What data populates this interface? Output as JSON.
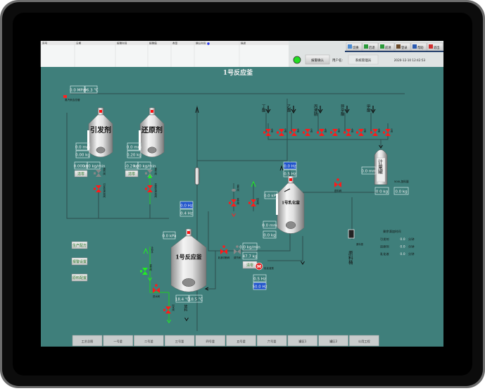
{
  "alarm_table": {
    "columns": [
      "序号",
      "日期",
      "报警时间",
      "报警值",
      "类型",
      "确认时间",
      "描述"
    ]
  },
  "toolbar": {
    "buttons": [
      {
        "label": "切换",
        "icon": "switch-icon"
      },
      {
        "label": "后退",
        "icon": "back-icon"
      },
      {
        "label": "前进",
        "icon": "forward-icon"
      },
      {
        "label": "登录",
        "icon": "user-icon"
      },
      {
        "label": "帮助",
        "icon": "help-icon"
      },
      {
        "label": "退出",
        "icon": "exit-icon"
      }
    ],
    "alarm_confirm": "报警确认",
    "user_label": "用户名:",
    "user_name": "系统管理员",
    "datetime": "2020-12-10 12:42:53",
    "status_color": "#22dd22"
  },
  "title": "1号反应釜",
  "steam": {
    "pressure": "0.0 MPa",
    "temp": "96.3 ℃",
    "label": "蒸汽来自总管"
  },
  "initiator": {
    "name": "引发剂",
    "level": "0.0 mm",
    "weight": "0.00 kg",
    "dose": "0.00 kg",
    "rate": "0.00 kg/min",
    "reset": "清零",
    "valve1": "调节阀",
    "valve2": "引发剂滴加阀"
  },
  "reducer": {
    "name": "还原剂",
    "level": "0.0 mm",
    "weight": "0.20 kg",
    "dose": "-0.2 kg",
    "rate": "0.00 kg/min",
    "reset": "清零",
    "valve1": "调节阀",
    "valve2": "还原剂滴加阀"
  },
  "monomers": [
    {
      "name": "丁酯"
    },
    {
      "name": "乙酯"
    },
    {
      "name": "丙烯腈"
    },
    {
      "name": "异辛酯"
    },
    {
      "name": "甲酯"
    }
  ],
  "monomer_valve_labels": [
    "大阀",
    "小阀"
  ],
  "metering_tank": {
    "name": "计量罐",
    "level": "0.0 mm",
    "weight": "0.0 kg",
    "dose_label": "500L加料量",
    "dose": "0.0 kg"
  },
  "emulsion_tank": {
    "name": "1号乳化釜",
    "freq_set": "0.0 Hz",
    "freq": "0.5 Hz",
    "pressure": "0.0 kPa",
    "level": "0.0 mm",
    "weight": "0.0 kg",
    "feed_valve": "进料阀"
  },
  "reactor": {
    "name": "1号反应釜",
    "freq_set": "0.0 Hz",
    "freq": "0.4 Hz",
    "pressure": "0.0 kPa",
    "temp1": "18.4 ℃",
    "temp2": "18.5 ℃",
    "discharge": "放料",
    "vent_valve": "放空阀",
    "water_valve": "回水阀",
    "cool_in": "冷却水",
    "reg_valve": "调节阀",
    "return_valve": "回水阀",
    "inlet_valve": "进水阀"
  },
  "pump": {
    "flow": "0.0 kg/min",
    "weight": "47.7 kg",
    "reset": "清零",
    "freq": "0.5 Hz",
    "freq_set": "50.0 Hz",
    "label": "乳化液泵",
    "valve1": "乳液切断阀",
    "valve2": "调节阀"
  },
  "left_buttons": [
    "生产配方",
    "报警设置",
    "原料配置"
  ],
  "raw_material": {
    "pump": "原料泵",
    "barrel": "原料桶"
  },
  "remaining": {
    "title": "剩余滴加时间",
    "rows": [
      {
        "name": "引发剂",
        "value": "0.0",
        "unit": "分钟"
      },
      {
        "name": "还原剂",
        "value": "0.0",
        "unit": "分钟"
      },
      {
        "name": "乳化液",
        "value": "0.0",
        "unit": "分钟"
      }
    ]
  },
  "nav_tabs": [
    "工艺总图",
    "一号釜",
    "二号釜",
    "三号釜",
    "四号釜",
    "五号釜",
    "六号釜",
    "罐区1",
    "罐区2",
    "公用工程"
  ],
  "colors": {
    "background": "#3f7f7b",
    "valve_closed": "#ff1a1a",
    "valve_open": "#22ee22",
    "value_blue": "#2255cc"
  }
}
